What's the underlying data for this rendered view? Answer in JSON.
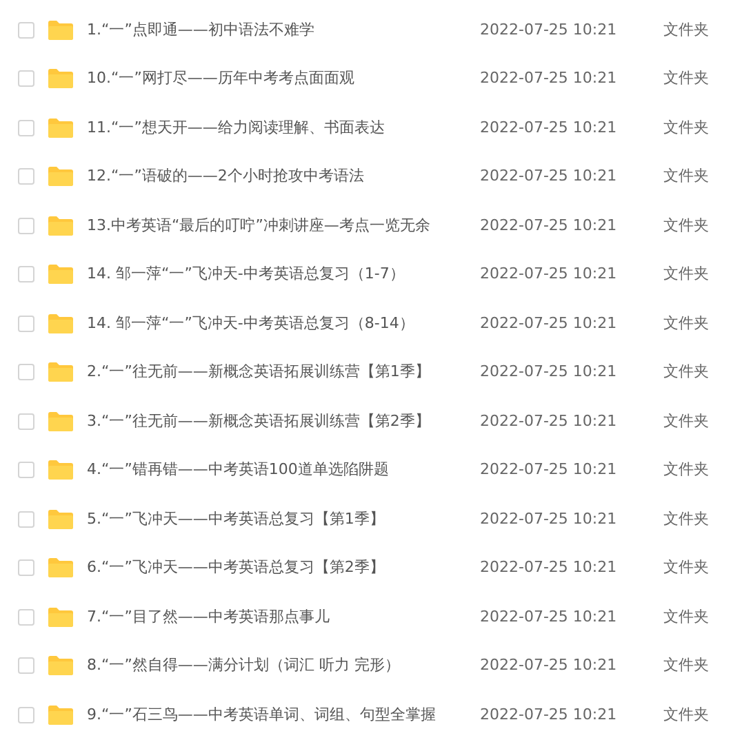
{
  "files": [
    {
      "name": "1.“一”点即通——初中语法不难学",
      "date": "2022-07-25 10:21",
      "type": "文件夹",
      "checked": false
    },
    {
      "name": "10.“一”网打尽——历年中考考点面面观",
      "date": "2022-07-25 10:21",
      "type": "文件夹",
      "checked": false
    },
    {
      "name": "11.“一”想天开——给力阅读理解、书面表达",
      "date": "2022-07-25 10:21",
      "type": "文件夹",
      "checked": false
    },
    {
      "name": "12.“一”语破的——2个小时抢攻中考语法",
      "date": "2022-07-25 10:21",
      "type": "文件夹",
      "checked": false
    },
    {
      "name": "13.中考英语“最后的叮咛”冲刺讲座—考点一览无余",
      "date": "2022-07-25 10:21",
      "type": "文件夹",
      "checked": false
    },
    {
      "name": "14. 邹一萍“一”飞冲天-中考英语总复习（1-7）",
      "date": "2022-07-25 10:21",
      "type": "文件夹",
      "checked": false
    },
    {
      "name": "14. 邹一萍“一”飞冲天-中考英语总复习（8-14）",
      "date": "2022-07-25 10:21",
      "type": "文件夹",
      "checked": false
    },
    {
      "name": "2.“一”往无前——新概念英语拓展训练营【第1季】",
      "date": "2022-07-25 10:21",
      "type": "文件夹",
      "checked": false
    },
    {
      "name": "3.“一”往无前——新概念英语拓展训练营【第2季】",
      "date": "2022-07-25 10:21",
      "type": "文件夹",
      "checked": false
    },
    {
      "name": "4.“一”错再错——中考英语100道单选陷阱题",
      "date": "2022-07-25 10:21",
      "type": "文件夹",
      "checked": false
    },
    {
      "name": "5.“一”飞冲天——中考英语总复习【第1季】",
      "date": "2022-07-25 10:21",
      "type": "文件夹",
      "checked": false
    },
    {
      "name": "6.“一”飞冲天——中考英语总复习【第2季】",
      "date": "2022-07-25 10:21",
      "type": "文件夹",
      "checked": false
    },
    {
      "name": "7.“一”目了然——中考英语那点事儿",
      "date": "2022-07-25 10:21",
      "type": "文件夹",
      "checked": false
    },
    {
      "name": "8.“一”然自得——满分计划（词汇 听力 完形）",
      "date": "2022-07-25 10:21",
      "type": "文件夹",
      "checked": false
    },
    {
      "name": "9.“一”石三鸟——中考英语单词、词组、句型全掌握",
      "date": "2022-07-25 10:21",
      "type": "文件夹",
      "checked": false
    }
  ]
}
